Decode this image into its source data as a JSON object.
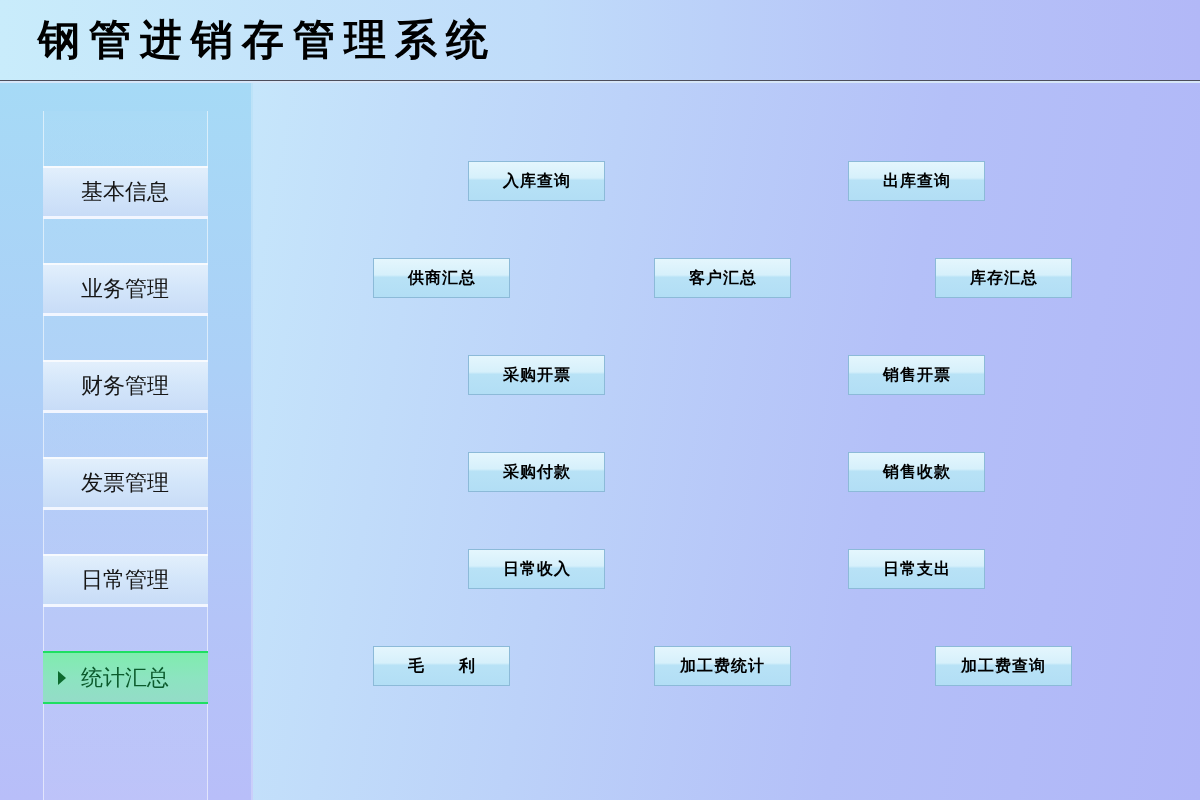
{
  "header": {
    "title": "钢管进销存管理系统"
  },
  "sidebar": {
    "items": [
      {
        "label": "基本信息",
        "selected": false
      },
      {
        "label": "业务管理",
        "selected": false
      },
      {
        "label": "财务管理",
        "selected": false
      },
      {
        "label": "发票管理",
        "selected": false
      },
      {
        "label": "日常管理",
        "selected": false
      },
      {
        "label": "统计汇总",
        "selected": true
      }
    ]
  },
  "content": {
    "button_rows": [
      {
        "buttons": [
          "入库查询",
          "出库查询"
        ]
      },
      {
        "buttons": [
          "供商汇总",
          "客户汇总",
          "库存汇总"
        ]
      },
      {
        "buttons": [
          "采购开票",
          "销售开票"
        ]
      },
      {
        "buttons": [
          "采购付款",
          "销售收款"
        ]
      },
      {
        "buttons": [
          "日常收入",
          "日常支出"
        ]
      },
      {
        "buttons": [
          "毛　　利",
          "加工费统计",
          "加工费查询"
        ]
      }
    ]
  }
}
